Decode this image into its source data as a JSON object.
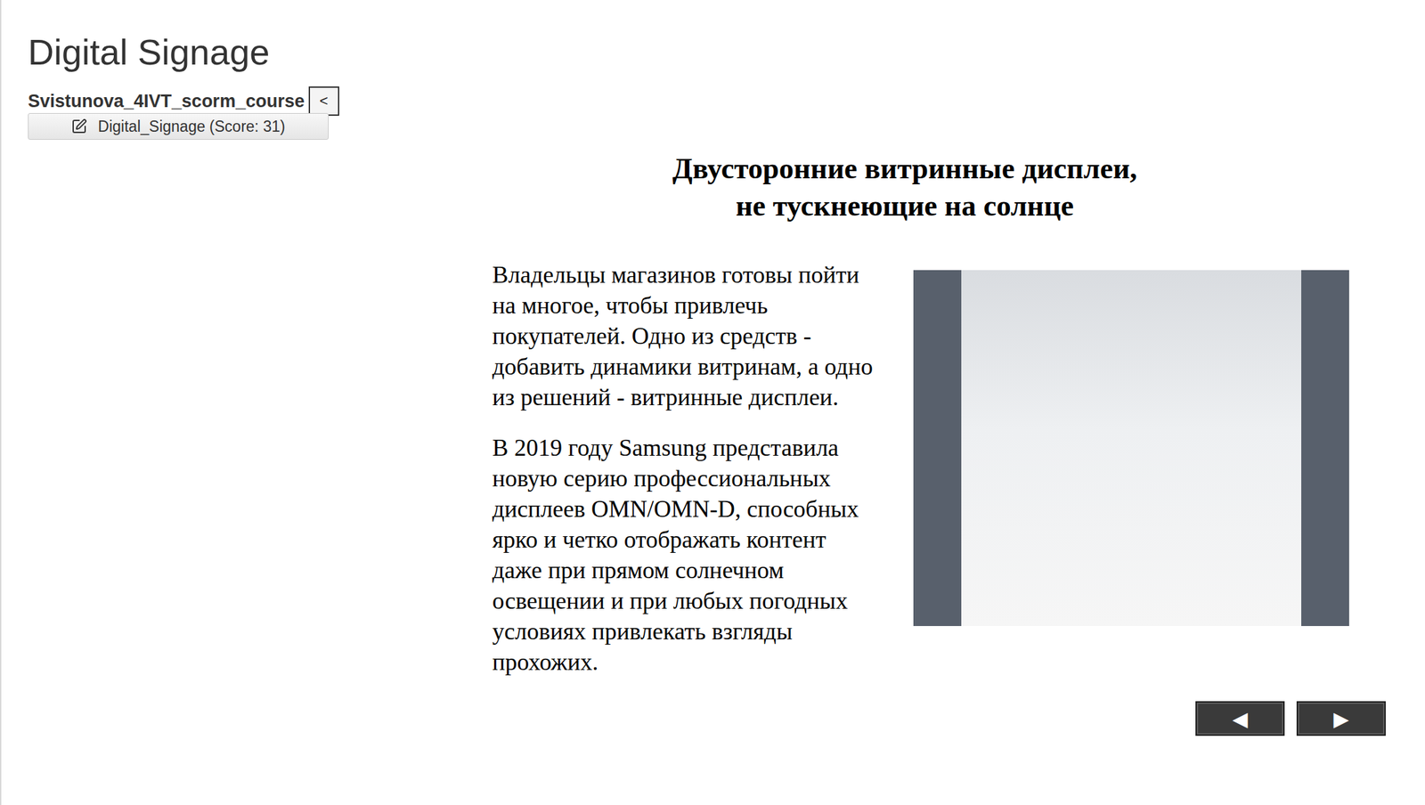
{
  "window": {
    "title": "Digital Signage"
  },
  "course": {
    "name": "Svistunova_4IVT_scorm_course",
    "collapse_button": "<",
    "items": [
      {
        "label": "Digital_Signage (Score: 31)",
        "selected": true
      }
    ]
  },
  "slide": {
    "heading": [
      "Двусторонние витринные дисплеи,",
      "не тускнеющие на солнце"
    ],
    "paragraphs": [
      "Владельцы магазинов готовы пойти на многое, чтобы привлечь покупателей. Одно из средств - добавить динамики витринам, а одно из решений - витринные дисплеи.",
      "В 2019 году Samsung представила новую серию профессиональных дисплеев OMN/OMN-D, способных ярко и четко отображать контент даже при прямом солнечном освещении и при любых погодных условиях привлекать взгляды прохожих."
    ]
  },
  "nav_buttons": [
    "◀",
    "▶"
  ]
}
